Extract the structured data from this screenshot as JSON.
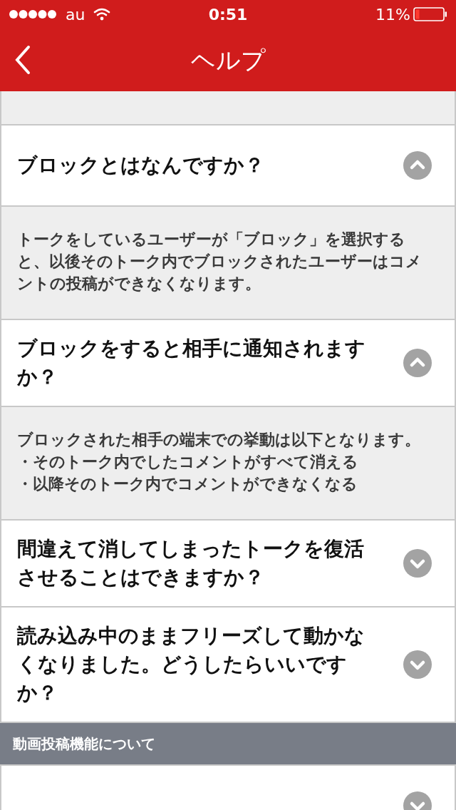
{
  "status_bar": {
    "carrier": "au",
    "time": "0:51",
    "battery": "11%"
  },
  "nav": {
    "title": "ヘルプ"
  },
  "items": [
    {
      "kind": "question",
      "question": "ブロックとはなんですか？",
      "expanded": true,
      "answer": [
        "トークをしているユーザーが「ブロック」を選択すると、以後そのトーク内でブロックされたユーザーはコメントの投稿ができなくなります。"
      ]
    },
    {
      "kind": "question",
      "question": "ブロックをすると相手に通知されますか？",
      "expanded": true,
      "answer": [
        "ブロックされた相手の端末での挙動は以下となります。",
        "・そのトーク内でしたコメントがすべて消える",
        "・以降そのトーク内でコメントができなくなる"
      ]
    },
    {
      "kind": "question",
      "question": "間違えて消してしまったトークを復活させることはできますか？",
      "expanded": false
    },
    {
      "kind": "question",
      "question": "読み込み中のままフリーズして動かなくなりました。どうしたらいいですか？",
      "expanded": false
    },
    {
      "kind": "section",
      "title": "動画投稿機能について"
    },
    {
      "kind": "question",
      "expanded": false
    }
  ]
}
